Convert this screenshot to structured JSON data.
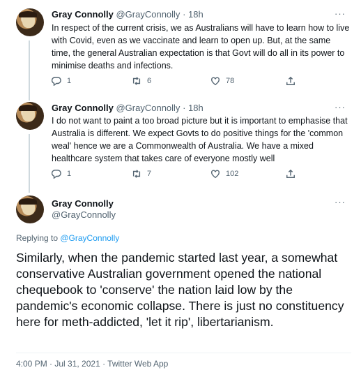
{
  "tweets": [
    {
      "name": "Gray Connolly",
      "handle": "@GrayConnolly",
      "separator": "·",
      "time": "18h",
      "more": "···",
      "text": "In respect of the current crisis, we as Australians will have to learn how to live with Covid, even as we vaccinate and learn to open up.  But, at the same time, the general Australian expectation is that Govt will do all in its power to minimise deaths and infections.",
      "replies": "1",
      "retweets": "6",
      "likes": "78"
    },
    {
      "name": "Gray Connolly",
      "handle": "@GrayConnolly",
      "separator": "·",
      "time": "18h",
      "more": "···",
      "text": "I do not want to paint a too broad picture but it is important to emphasise that Australia is different. We expect Govts to do positive things for the 'common weal' hence we are a Commonwealth of Australia. We have a mixed healthcare system that takes care of everyone mostly well",
      "replies": "1",
      "retweets": "7",
      "likes": "102"
    }
  ],
  "focused": {
    "name": "Gray Connolly",
    "handle": "@GrayConnolly",
    "more": "···",
    "replying_label": "Replying to ",
    "replying_handle": "@GrayConnolly",
    "text": "Similarly, when the pandemic started last year, a somewhat conservative Australian government opened the national chequebook to 'conserve' the nation laid low by the pandemic's economic collapse. There is just no constituency here for meth-addicted, 'let it rip', libertarianism.",
    "timestamp": "4:00 PM · Jul 31, 2021 · Twitter Web App"
  }
}
